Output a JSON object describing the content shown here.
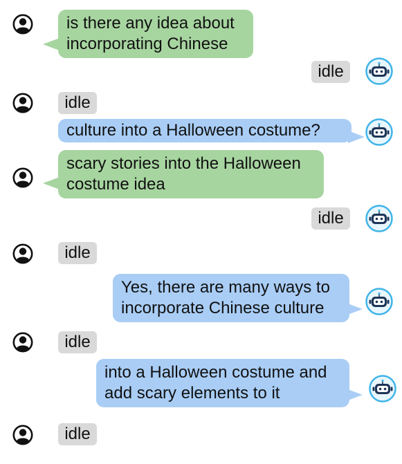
{
  "chat": {
    "messages": [
      {
        "sender": "user",
        "style": "green",
        "text": "is there any idea about\nincorporating Chinese"
      },
      {
        "sender": "bot",
        "style": "idle",
        "text": "idle"
      },
      {
        "sender": "user",
        "style": "idle",
        "text": "idle"
      },
      {
        "sender": "bot",
        "style": "blue",
        "text": "culture into a Halloween costume?"
      },
      {
        "sender": "user",
        "style": "green",
        "text": "scary stories into the Halloween\ncostume idea"
      },
      {
        "sender": "bot",
        "style": "idle",
        "text": "idle"
      },
      {
        "sender": "user",
        "style": "idle",
        "text": "idle"
      },
      {
        "sender": "bot",
        "style": "blue",
        "text": "Yes, there are many ways to\nincorporate Chinese culture"
      },
      {
        "sender": "user",
        "style": "idle",
        "text": "idle"
      },
      {
        "sender": "bot",
        "style": "blue",
        "text": " into a Halloween costume and\nadd scary elements to it"
      },
      {
        "sender": "user",
        "style": "idle",
        "text": "idle"
      }
    ]
  },
  "colors": {
    "user_bubble": "#a7d5a0",
    "bot_bubble": "#a9cdf5",
    "idle_bubble": "#d9d9d9",
    "bot_avatar_ring": "#3fb4e8"
  },
  "icons": {
    "user": "user-avatar-icon",
    "bot": "robot-avatar-icon"
  }
}
